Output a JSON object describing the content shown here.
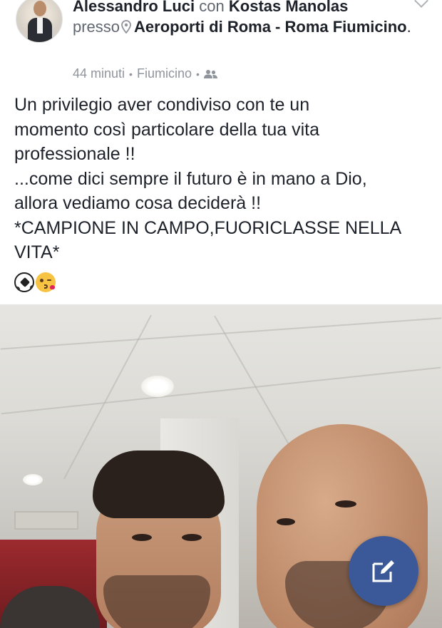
{
  "header": {
    "author": "Alessandro Luci",
    "with_word": "con",
    "tagged": "Kostas Manolas",
    "at_word": "presso",
    "location": "Aeroporti di Roma - Roma Fiumicino",
    "location_suffix": ".",
    "time": "44 minuti",
    "separator": "•",
    "place": "Fiumicino",
    "audience_icon": "friends-icon"
  },
  "post": {
    "text": "Un privilegio aver condiviso con te un\nmomento così particolare della tua vita\nprofessionale !!\n...come dici sempre il futuro è in mano a Dio,\nallora vediamo cosa deciderà !!\n*CAMPIONE IN CAMPO,FUORICLASSE NELLA\nVITA*",
    "emojis": [
      "soccer-ball-icon",
      "kissing-wink-face-icon"
    ]
  },
  "colors": {
    "text": "#1d2129",
    "muted": "#90949c",
    "fab": "#3b5998"
  },
  "fab": {
    "icon": "edit-icon"
  }
}
